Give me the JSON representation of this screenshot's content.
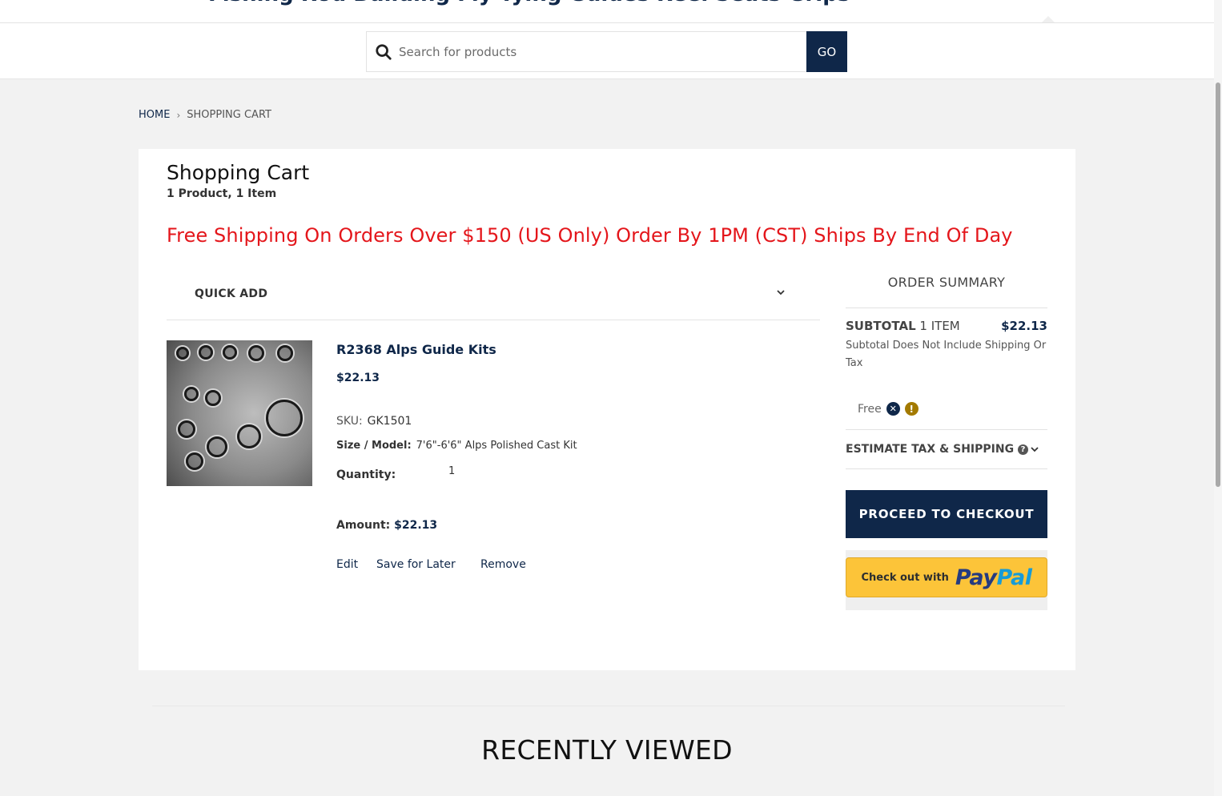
{
  "header": {
    "clipped_heading": "Fishing Rod Building Fly Tying Guides Reel Seats Grips",
    "search": {
      "placeholder": "Search for products",
      "button_label": "GO"
    }
  },
  "breadcrumb": {
    "home": "HOME",
    "current": "SHOPPING CART"
  },
  "cart": {
    "title": "Shopping Cart",
    "subtitle": "1 Product, 1 Item",
    "promo": "Free Shipping On Orders Over $150 (US Only) Order By 1PM (CST) Ships By End Of Day",
    "quick_add": "QUICK ADD",
    "item": {
      "name": "R2368 Alps Guide Kits",
      "price": "$22.13",
      "sku_label": "SKU:",
      "sku": "GK1501",
      "size_label": "Size / Model:",
      "size": "7'6\"-6'6\" Alps Polished Cast Kit",
      "quantity_label": "Quantity:",
      "quantity": "1",
      "amount_label": "Amount:",
      "amount": "$22.13",
      "actions": {
        "edit": "Edit",
        "save": "Save for Later",
        "remove": "Remove"
      }
    }
  },
  "summary": {
    "title": "ORDER SUMMARY",
    "subtotal_label": "SUBTOTAL",
    "subtotal_items": "1 ITEM",
    "subtotal_amount": "$22.13",
    "subtotal_note": "Subtotal Does Not Include Shipping Or Tax",
    "shipping_free": "Free",
    "estimate_label": "ESTIMATE TAX & SHIPPING",
    "checkout_label": "PROCEED TO CHECKOUT",
    "paypal_small": "Check out with",
    "paypal_pay": "Pay",
    "paypal_pal": "Pal"
  },
  "recently_viewed": "RECENTLY VIEWED",
  "colors": {
    "brand_navy": "#0f2749",
    "promo_red": "#e4161b",
    "paypal_yellow": "#fcc439"
  }
}
